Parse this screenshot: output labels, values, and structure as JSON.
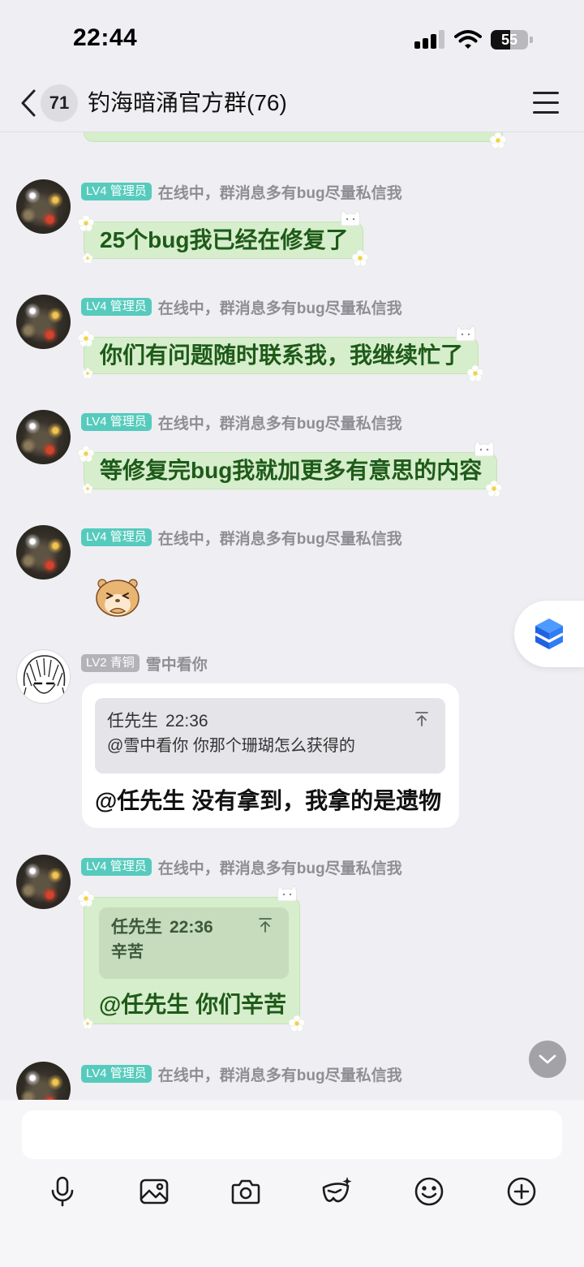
{
  "status_bar": {
    "time": "22:44",
    "battery_level": "55",
    "signal_icon": "cellular-signal-icon",
    "wifi_icon": "wifi-icon"
  },
  "header": {
    "back_icon": "chevron-left-icon",
    "unread_count": "71",
    "title": "钓海暗涌官方群(76)",
    "menu_icon": "hamburger-menu-icon"
  },
  "messages": [
    {
      "tag": "LV4 管理员",
      "nickname": "在线中，群消息多有bug尽量私信我",
      "type": "text",
      "text": "25个bug我已经在修复了"
    },
    {
      "tag": "LV4 管理员",
      "nickname": "在线中，群消息多有bug尽量私信我",
      "type": "text",
      "text": "你们有问题随时联系我，我继续忙了"
    },
    {
      "tag": "LV4 管理员",
      "nickname": "在线中，群消息多有bug尽量私信我",
      "type": "text",
      "text": "等修复完bug我就加更多有意思的内容"
    },
    {
      "tag": "LV4 管理员",
      "nickname": "在线中，群消息多有bug尽量私信我",
      "type": "sticker",
      "sticker": "hamster-sticker"
    },
    {
      "tag": "LV2 青铜",
      "nickname": "雪中看你",
      "type": "reply",
      "quote": {
        "author": "任先生",
        "time": "22:36",
        "text": "@雪中看你 你那个珊瑚怎么获得的"
      },
      "text": "@任先生 没有拿到，我拿的是遗物"
    },
    {
      "tag": "LV4 管理员",
      "nickname": "在线中，群消息多有bug尽量私信我",
      "type": "reply",
      "quote": {
        "author": "任先生",
        "time": "22:36",
        "text": "辛苦"
      },
      "text": "@任先生 你们辛苦"
    },
    {
      "tag": "LV4 管理员",
      "nickname": "在线中，群消息多有bug尽量私信我",
      "type": "partial"
    }
  ],
  "floating_widget": {
    "icon": "blue-cube-icon"
  },
  "scroll_down_button": {
    "icon": "chevron-down-icon"
  },
  "input_bar": {
    "tools": [
      "microphone-icon",
      "image-icon",
      "camera-icon",
      "mask-sparkle-icon",
      "smiley-icon",
      "plus-circle-icon"
    ]
  },
  "colors": {
    "background": "#eeeef3",
    "admin_tag": "#56cbbd",
    "bronze_tag": "#b3b3b8",
    "bubble_green": "#d6eecb",
    "bubble_text": "#1e5a1a",
    "quote_green": "#c6dcbd",
    "quote_gray": "#e4e4e9"
  }
}
